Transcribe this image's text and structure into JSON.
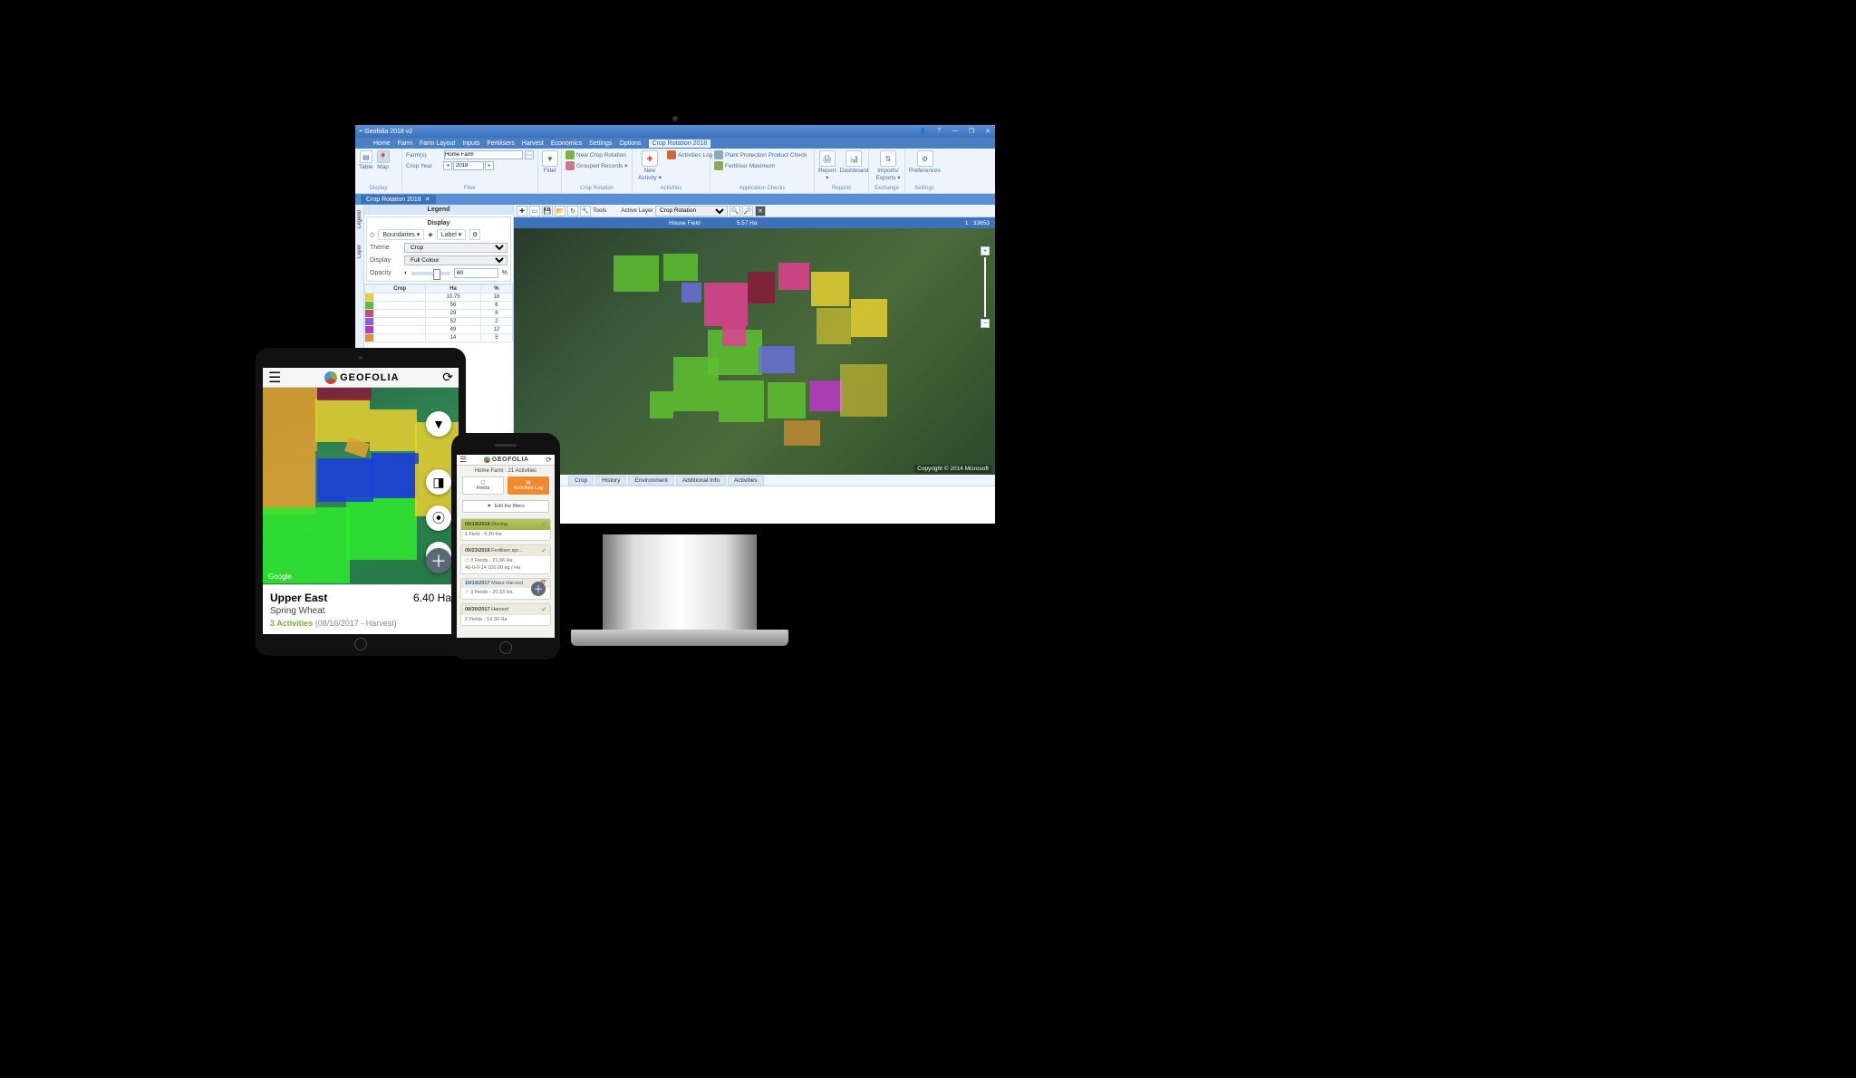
{
  "desktop": {
    "title": "Geofolia 2018 v2",
    "menu": [
      "Home",
      "Farm",
      "Farm Layout",
      "Inputs",
      "Fertilisers",
      "Harvest",
      "Economics",
      "Settings",
      "Options",
      "Crop Rotation 2018"
    ],
    "active_menu_index": 9,
    "ribbon": {
      "display": {
        "label": "Display",
        "table": "Table",
        "map": "Map"
      },
      "filter": {
        "label": "Filter",
        "farms_label": "Farm(s)",
        "farms_value": "Home Farm",
        "cropyear_label": "Crop Year",
        "cropyear_value": "2018",
        "filter_btn": "Filter"
      },
      "croprot": {
        "label": "Crop Rotation",
        "new": "New Crop Rotation",
        "grouped": "Grouped Records ▾"
      },
      "activities": {
        "label": "Activities",
        "new": "New Activity ▾",
        "log": "Activities Log"
      },
      "checks": {
        "label": "Application Checks",
        "ppp": "Plant Protection Product Check",
        "fertmax": "Fertiliser Maximum"
      },
      "reports": {
        "label": "Reports",
        "report": "Report ▾",
        "dashboard": "Dashboard"
      },
      "exchange": {
        "label": "Exchange",
        "imports": "Imports/ Exports ▾"
      },
      "settings": {
        "label": "Settings",
        "prefs": "Preferences"
      }
    },
    "document_tab": {
      "label": "Crop Rotation 2018"
    },
    "side_tabs": [
      "Legend",
      "Layer"
    ],
    "legend": {
      "header": "Legend",
      "display_header": "Display",
      "boundaries": "Boundaries ▾",
      "label_chip": "Label ▾",
      "theme_label": "Theme",
      "theme_value": "Crop",
      "display_label": "Display",
      "display_value": "Full Colour",
      "opacity_label": "Opacity",
      "opacity_value": "60",
      "opacity_unit": "%",
      "table_headers": [
        "",
        "Crop",
        "Ha",
        "%"
      ],
      "table_rows": [
        [
          "",
          "",
          "10.75",
          "18"
        ],
        [
          "",
          "",
          "56",
          "6"
        ],
        [
          "",
          "",
          "29",
          "8"
        ],
        [
          "",
          "",
          "52",
          "2"
        ],
        [
          "",
          "",
          "49",
          "12"
        ],
        [
          "",
          "",
          "14",
          "5"
        ]
      ]
    },
    "map_toolbar": {
      "tools_label": "Tools",
      "active_layer_label": "Active Layer",
      "active_layer_value": "Crop Rotation"
    },
    "map_info": {
      "field_name": "House Field",
      "area": "5.57 Ha",
      "scale": "1 : 33653"
    },
    "copyright": "Copyright © 2014 Microsoft",
    "bottom_tabs": [
      "Crop",
      "History",
      "Environment",
      "Additional Info",
      "Activities"
    ]
  },
  "tablet": {
    "brand": "GEOFOLIA",
    "google": "Google",
    "field": {
      "name": "Upper East",
      "area": "6.40 Ha",
      "crop": "Spring Wheat",
      "activities_count": "3 Activities",
      "activities_detail": "(08/16/2017 - Harvest)"
    }
  },
  "phone": {
    "brand": "GEOFOLIA",
    "subtitle_farm": "Home Farm",
    "subtitle_count": "21 Activities",
    "toggle_fields": "Fields",
    "toggle_log": "Activities Log",
    "filter_btn": "Edit the filters",
    "cards": [
      {
        "date": "09/19/2018",
        "title": "Discing",
        "body": "1 Field - 5.20 Ha",
        "selected": true
      },
      {
        "date": "09/23/2018",
        "title": "Fertiliser spr...",
        "body1": "3 Fields - 21.96 Ha",
        "body2": "40-0-0-14 100.00 kg / Ha"
      },
      {
        "date": "10/10/2017",
        "title": "Maize Harvest",
        "body1": "3 Fields - 20.33 Ha",
        "blue": true,
        "calendar": true
      },
      {
        "date": "08/30/2017",
        "title": "Harvest",
        "body1": "2 Fields - 14.36 Ha"
      }
    ]
  }
}
